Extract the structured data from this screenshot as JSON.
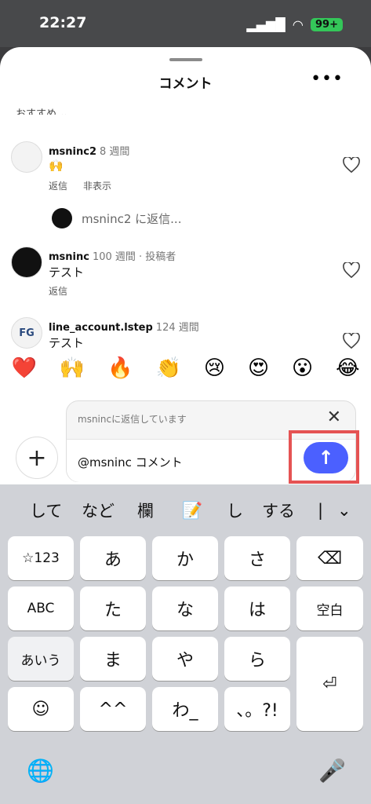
{
  "status": {
    "time": "22:27",
    "battery": "99+"
  },
  "sheet": {
    "title": "コメント",
    "more": "•••",
    "sort_label": "おすすめ ⌄"
  },
  "comments": [
    {
      "username": "msninc2",
      "meta": "8 週間",
      "text": "🙌",
      "actions": [
        "返信",
        "非表示"
      ]
    },
    {
      "username": "msninc",
      "meta": "100 週間 · 投稿者",
      "text": "テスト",
      "actions": [
        "返信"
      ]
    },
    {
      "username": "line_account.lstep",
      "meta": "124 週間",
      "text": "テスト",
      "actions": []
    }
  ],
  "reply_to_row": "msninc2 に返信...",
  "emojis": [
    "❤️",
    "🙌",
    "🔥",
    "👏",
    "😢",
    "😍",
    "😮",
    "😂"
  ],
  "composer": {
    "replying_label": "msnincに返信しています",
    "close": "✕",
    "value": "@msninc コメント",
    "plus": "+",
    "send": "↑"
  },
  "keyboard": {
    "candidates": [
      "して",
      "など",
      "欄",
      "📝",
      "し",
      "する",
      "|"
    ],
    "rows": [
      [
        "☆123",
        "あ",
        "か",
        "さ",
        "⌫"
      ],
      [
        "ABC",
        "た",
        "な",
        "は",
        "空白"
      ],
      [
        "あいう",
        "ま",
        "や",
        "ら",
        "⏎"
      ],
      [
        "☺",
        "^^",
        "わ_",
        "、。?!"
      ]
    ],
    "bottom": {
      "globe": "🌐",
      "mic": "🎤"
    },
    "chevron": "⌄"
  },
  "avatar_logo": "FG"
}
